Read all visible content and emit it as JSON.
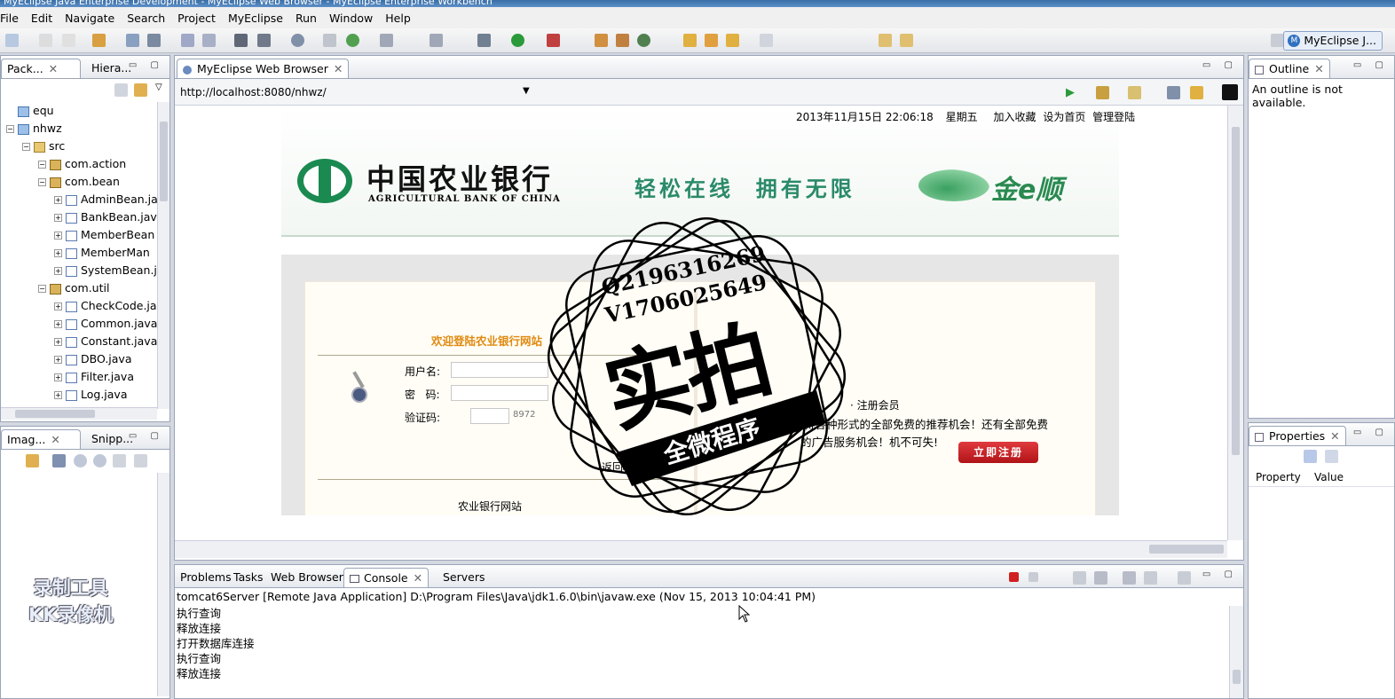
{
  "window": {
    "title": "MyEclipse Java Enterprise Development - MyEclipse Web Browser - MyEclipse Enterprise Workbench"
  },
  "menu": [
    "File",
    "Edit",
    "Navigate",
    "Search",
    "Project",
    "MyEclipse",
    "Run",
    "Window",
    "Help"
  ],
  "perspective": {
    "label": "MyEclipse J...",
    "icon": "myeclipse-perspective-icon"
  },
  "package_explorer": {
    "tabs": [
      {
        "label": "Pack..."
      },
      {
        "label": "Hiera..."
      }
    ],
    "tree": [
      {
        "label": "equ",
        "type": "project",
        "indent": 0
      },
      {
        "label": "nhwz",
        "type": "project",
        "indent": 0
      },
      {
        "label": "src",
        "type": "src",
        "indent": 1
      },
      {
        "label": "com.action",
        "type": "package",
        "indent": 2
      },
      {
        "label": "com.bean",
        "type": "package",
        "indent": 2
      },
      {
        "label": "AdminBean.ja",
        "type": "java",
        "indent": 3
      },
      {
        "label": "BankBean.jav",
        "type": "java",
        "indent": 3
      },
      {
        "label": "MemberBean",
        "type": "java",
        "indent": 3
      },
      {
        "label": "MemberMan",
        "type": "java",
        "indent": 3
      },
      {
        "label": "SystemBean.j",
        "type": "java",
        "indent": 3
      },
      {
        "label": "com.util",
        "type": "package",
        "indent": 2
      },
      {
        "label": "CheckCode.ja",
        "type": "java",
        "indent": 3
      },
      {
        "label": "Common.java",
        "type": "java",
        "indent": 3
      },
      {
        "label": "Constant.java",
        "type": "java",
        "indent": 3
      },
      {
        "label": "DBO.java",
        "type": "java",
        "indent": 3
      },
      {
        "label": "Filter.java",
        "type": "java",
        "indent": 3
      },
      {
        "label": "Log.java",
        "type": "java",
        "indent": 3
      }
    ]
  },
  "image_panel": {
    "tabs": [
      {
        "label": "Imag..."
      },
      {
        "label": "Snipp..."
      }
    ]
  },
  "browser": {
    "tab_label": "MyEclipse Web Browser",
    "url": "http://localhost:8080/nhwz/",
    "page": {
      "datetime": "2013年11月15日 22:06:18",
      "weekday": "星期五",
      "links": [
        "加入收藏",
        "设为首页",
        "管理登陆"
      ],
      "bank_name_cn": "中国农业银行",
      "bank_name_en": "AGRICULTURAL BANK OF CHINA",
      "slogan": "轻松在线  拥有无限",
      "brand": "金e顺",
      "welcome": "欢迎登陆农业银行网站",
      "username_label": "用户名:",
      "password_label": "密   码:",
      "captcha_label": "验证码:",
      "captcha_value": "8972",
      "back_link": "返回",
      "footer": "农业银行网站",
      "register_title": "· 注册会员",
      "register_text_1": "有机会获得各种形式的全部免费的推荐机会！还有全部免费",
      "register_text_2": "的广告服务机会！机不可失!",
      "register_button": "立即注册"
    }
  },
  "outline": {
    "tab_label": "Outline",
    "message": "An outline is not available."
  },
  "properties": {
    "tab_label": "Properties",
    "columns": [
      "Property",
      "Value"
    ]
  },
  "bottom_tabs": [
    {
      "label": "Problems"
    },
    {
      "label": "Tasks"
    },
    {
      "label": "Web Browser"
    },
    {
      "label": "Console"
    },
    {
      "label": "Servers"
    }
  ],
  "console": {
    "header": "tomcat6Server [Remote Java Application] D:\\Program Files\\Java\\jdk1.6.0\\bin\\javaw.exe (Nov 15, 2013 10:04:41 PM)",
    "lines": [
      "执行查询",
      "释放连接",
      "打开数据库连接",
      "执行查询",
      "释放连接"
    ]
  },
  "stamp": {
    "line1": "Q2196316269",
    "line2": "V1706025649",
    "big": "实拍",
    "banner": "全微程序"
  },
  "watermark": {
    "line1": "录制工具",
    "line2": "KK录像机"
  },
  "colors": {
    "accent_green": "#1a8a50",
    "register_red": "#c0181c",
    "welcome_orange": "#e08a10"
  }
}
